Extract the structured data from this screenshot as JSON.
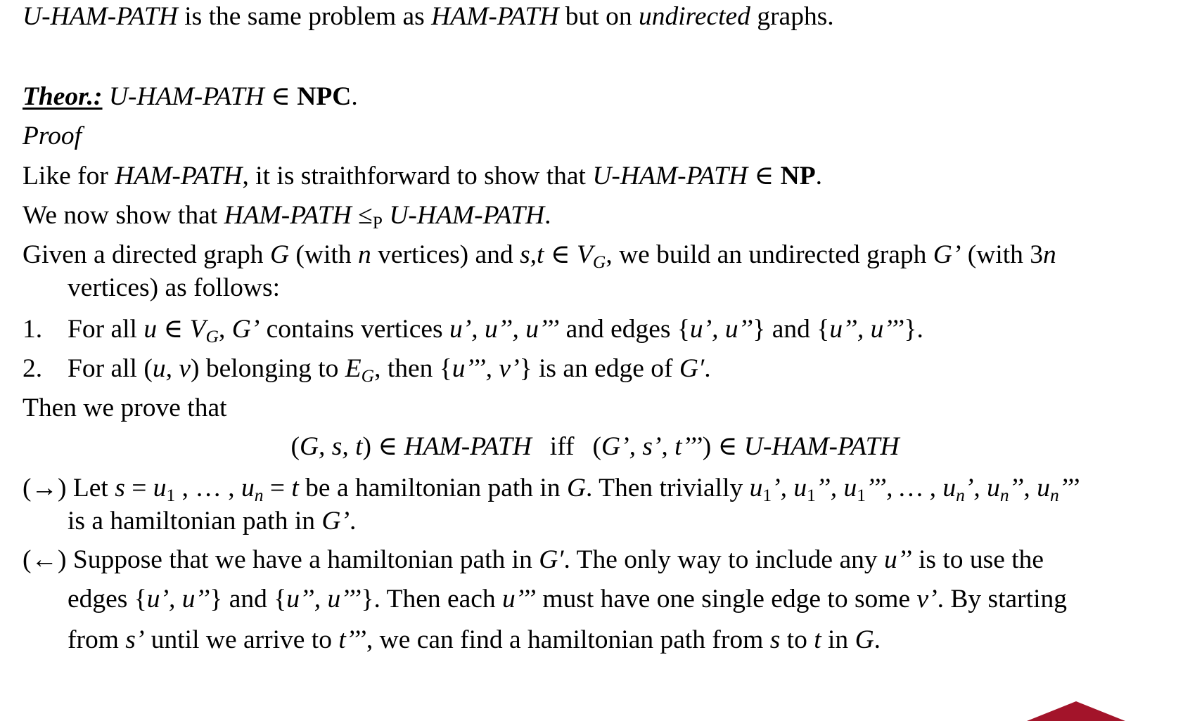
{
  "line1": {
    "t1": "U-HAM-PATH",
    "t2": " is the same problem as ",
    "t3": "HAM-PATH",
    "t4": " but on ",
    "t5": "undirected",
    "t6": " graphs."
  },
  "theorem": {
    "label": "Theor.:",
    "t1": " U-HAM-PATH",
    "t2": " ∈ ",
    "t3": "NPC",
    "t4": "."
  },
  "proof_label": "Proof",
  "like": {
    "t1": "Like for ",
    "t2": "HAM-PATH",
    "t3": ", it is straithforward to show that ",
    "t4": "U-HAM-PATH",
    "t5": " ∈ ",
    "t6": "NP",
    "t7": "."
  },
  "wenow": {
    "t1": "We now show that ",
    "t2": "HAM-PATH",
    "t3": " ≤",
    "t4": "P",
    "t5": " U-HAM-PATH",
    "t6": "."
  },
  "given": {
    "t1": "Given a directed graph ",
    "t2": "G",
    "t3": " (with ",
    "t4": "n",
    "t5": " vertices) and ",
    "t6": "s,t",
    "t7": " ∈ ",
    "t8": "V",
    "t9": "G",
    "t10": ", we build an undirected graph ",
    "t11": "G’",
    "t12": " (with 3",
    "t13": "n",
    "l2": "vertices) as follows:"
  },
  "item1": {
    "num": "1.",
    "t1": "For all ",
    "t2": "u",
    "t3": " ∈ ",
    "t4": "V",
    "t5": "G",
    "t6": ", ",
    "t7": "G’",
    "t8": " contains vertices ",
    "t9": "u’, u’’, u’’’",
    "t10": " and edges {",
    "t11": "u’, u’’",
    "t12": "} and {",
    "t13": "u’’, u’’’",
    "t14": "}."
  },
  "item2": {
    "num": "2.",
    "t1": "For all (",
    "t2": "u, v",
    "t3": ") belonging to ",
    "t4": "E",
    "t5": "G",
    "t6": ", then  {",
    "t7": "u’’’, v’",
    "t8": "} is an edge of ",
    "t9": "G′",
    "t10": "."
  },
  "then_prove": "Then we prove that",
  "iff": {
    "t1": "(",
    "t2": "G, s, t",
    "t3": ") ∈ ",
    "t4": "HAM-PATH",
    "t5": "iff",
    "t6": "(",
    "t7": "G’, s’, t’’’",
    "t8": ") ∈ ",
    "t9": "U-HAM-PATH"
  },
  "forward": {
    "arrow": "(→)",
    "t1": " Let   ",
    "t2": "s",
    "t3": " = ",
    "t4": "u",
    "t5": "1",
    "t6": " , … , ",
    "t7": "u",
    "t8": "n",
    "t9": " = ",
    "t10": "t",
    "t11": "  be a hamiltonian path in ",
    "t12": "G",
    "t13": ". Then trivially   ",
    "t14": "u",
    "t15": "1",
    "t16": "’, ",
    "t17": "u",
    "t18": "1",
    "t19": "’’, ",
    "t20": "u",
    "t21": "1",
    "t22": "’’’, … , ",
    "t23": "u",
    "t24": "n",
    "t25": "’, ",
    "t26": "u",
    "t27": "n",
    "t28": "’’, ",
    "t29": "u",
    "t30": "n",
    "t31": "’’’",
    "l2a": "is a hamiltonian path in ",
    "l2b": "G’",
    "l2c": "."
  },
  "backward": {
    "arrow": "(←)",
    "t1": " Suppose that we have a hamiltonian path in ",
    "t2": "G′",
    "t3": ". The only way to include any ",
    "t4": "u’’",
    "t5": " is to use the",
    "l2a": "edges {",
    "l2b": "u’, u’’",
    "l2c": "} and {",
    "l2d": "u’’, u’’’",
    "l2e": "}. Then each ",
    "l2f": "u’’’",
    "l2g": " must have one single edge to some ",
    "l2h": "v’",
    "l2i": ". By starting",
    "l3a": "from ",
    "l3b": "s’",
    "l3c": " until we arrive to ",
    "l3d": "t’’’",
    "l3e": ", we can find a hamiltonian path from ",
    "l3f": "s",
    "l3g": " to ",
    "l3h": "t",
    "l3i": " in ",
    "l3j": "G",
    "l3k": "."
  },
  "colors": {
    "accent": "#A3142A"
  }
}
